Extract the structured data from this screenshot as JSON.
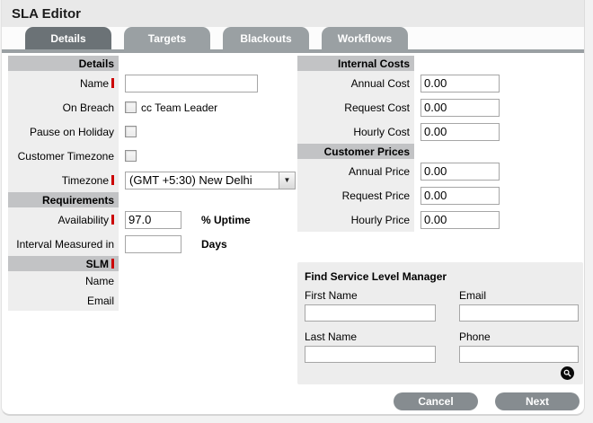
{
  "window": {
    "title": "SLA Editor"
  },
  "tabs": [
    {
      "label": "Details",
      "active": true
    },
    {
      "label": "Targets",
      "active": false
    },
    {
      "label": "Blackouts",
      "active": false
    },
    {
      "label": "Workflows",
      "active": false
    }
  ],
  "details": {
    "heading": "Details",
    "name": {
      "label": "Name",
      "required": true,
      "value": ""
    },
    "on_breach": {
      "label": "On Breach",
      "checkbox_label": "cc Team Leader",
      "checked": false
    },
    "pause_on_holiday": {
      "label": "Pause on Holiday",
      "checked": false
    },
    "customer_timezone": {
      "label": "Customer Timezone",
      "checked": false
    },
    "timezone": {
      "label": "Timezone",
      "required": true,
      "selected": "(GMT +5:30) New Delhi"
    }
  },
  "requirements": {
    "heading": "Requirements",
    "availability": {
      "label": "Availability",
      "required": true,
      "value": "97.0",
      "suffix": "% Uptime"
    },
    "interval": {
      "label": "Interval Measured in",
      "value": "",
      "suffix": "Days"
    }
  },
  "slm": {
    "heading": "SLM",
    "required": true,
    "name_label": "Name",
    "email_label": "Email"
  },
  "internal_costs": {
    "heading": "Internal Costs",
    "rows": [
      {
        "label": "Annual Cost",
        "value": "0.00"
      },
      {
        "label": "Request Cost",
        "value": "0.00"
      },
      {
        "label": "Hourly Cost",
        "value": "0.00"
      }
    ]
  },
  "customer_prices": {
    "heading": "Customer Prices",
    "rows": [
      {
        "label": "Annual Price",
        "value": "0.00"
      },
      {
        "label": "Request Price",
        "value": "0.00"
      },
      {
        "label": "Hourly Price",
        "value": "0.00"
      }
    ]
  },
  "find_slm": {
    "heading": "Find Service Level Manager",
    "first_name": {
      "label": "First Name",
      "value": ""
    },
    "email": {
      "label": "Email",
      "value": ""
    },
    "last_name": {
      "label": "Last Name",
      "value": ""
    },
    "phone": {
      "label": "Phone",
      "value": ""
    },
    "search_icon": "magnifier-circle"
  },
  "footer": {
    "cancel_label": "Cancel",
    "next_label": "Next"
  },
  "icons": {
    "timezone_dropdown": "chevron-down",
    "find_search": "magnifier-circle"
  },
  "colors": {
    "required_marker": "#cc0000",
    "tab_active": "#6b7276",
    "tab_inactive": "#9aa0a3",
    "tab_underbar": "#9aa0a3",
    "section_header_bg": "#c2c3c5",
    "label_column_bg": "#eeeeee",
    "titlebar_bg": "#e9e9e9",
    "button_bg": "#868c90",
    "find_box_bg": "#ededed",
    "input_border": "#a6a6a6"
  }
}
